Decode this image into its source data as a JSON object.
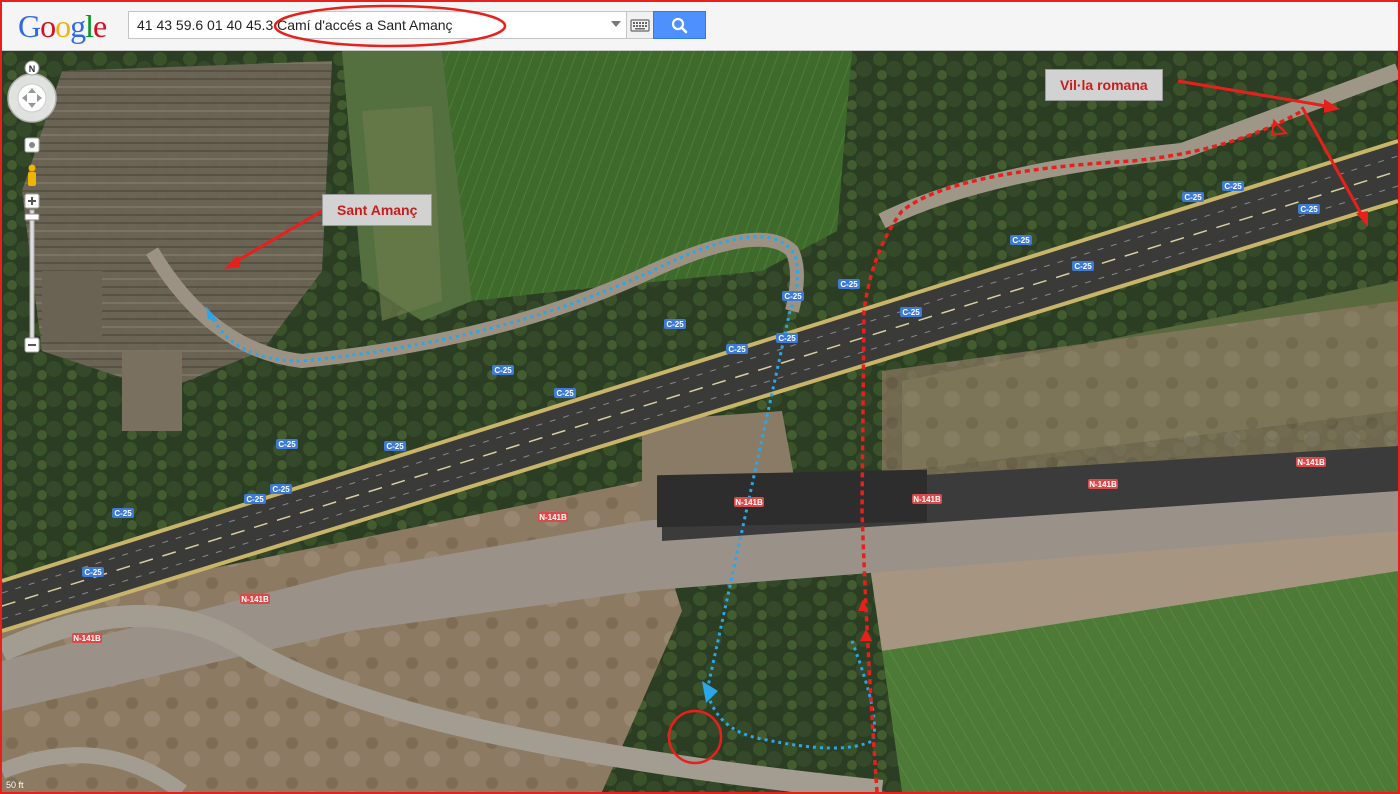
{
  "search": {
    "value": "41 43 59.6 01 40 45.3 Camí d'accés a Sant Amanç"
  },
  "logo": {
    "letters": [
      {
        "ch": "G",
        "color": "#3369e8"
      },
      {
        "ch": "o",
        "color": "#d50f25"
      },
      {
        "ch": "o",
        "color": "#eeb211"
      },
      {
        "ch": "g",
        "color": "#3369e8"
      },
      {
        "ch": "l",
        "color": "#009925"
      },
      {
        "ch": "e",
        "color": "#d50f25"
      }
    ]
  },
  "compass": {
    "north": "N"
  },
  "annotations": {
    "sant_amanc": "Sant Amanç",
    "villa_romana": "Vil·la romana"
  },
  "road_labels": {
    "c25": "C-25",
    "n141b": "N-141B"
  },
  "scale": {
    "label": "50 ft"
  },
  "colors": {
    "annotation_red": "#e8201c",
    "route_blue": "#2aa7e8",
    "route_red": "#e8201c",
    "road_shield_blue": "#3d7bd6",
    "road_shield_red": "#d74b4b"
  }
}
